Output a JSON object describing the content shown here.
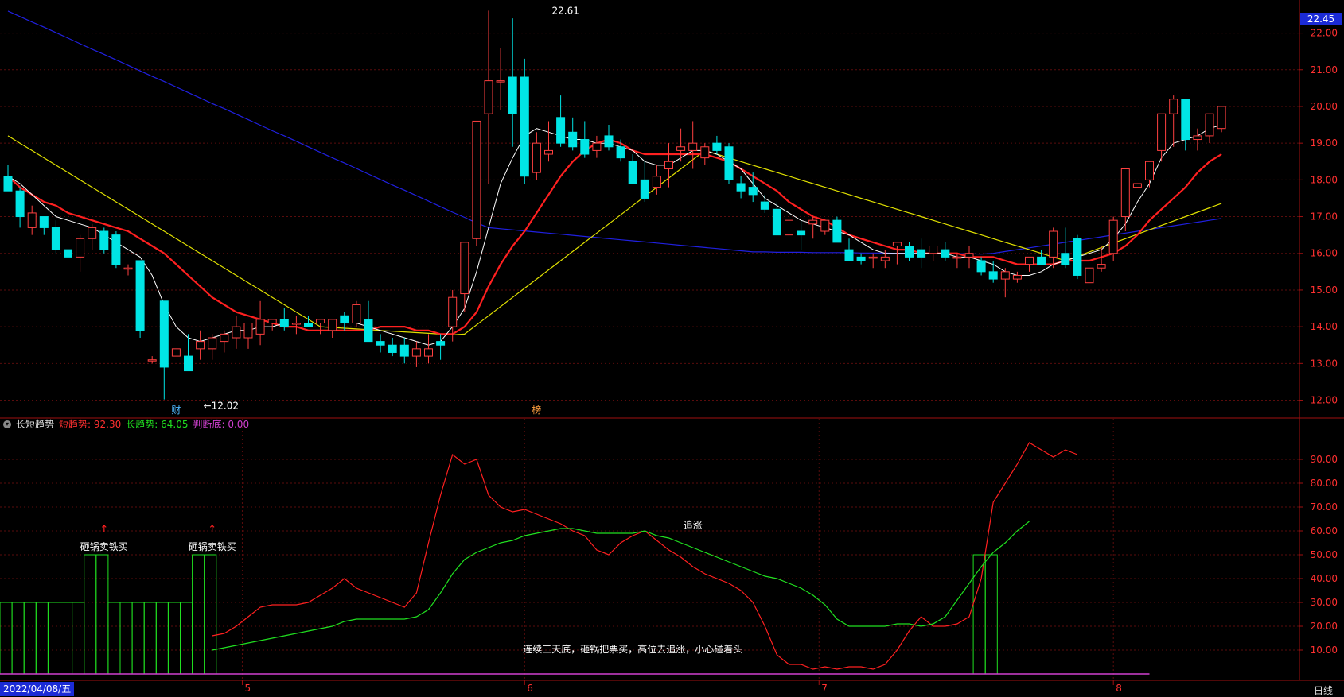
{
  "app": {
    "period_label": "日线",
    "last_price": "22.45",
    "date_label": "2022/04/08/五"
  },
  "indicator": {
    "name": "长短趋势",
    "short_label": "短趋势:",
    "short_value": "92.30",
    "long_label": "长趋势:",
    "long_value": "64.05",
    "judge_label": "判断底:",
    "judge_value": "0.00",
    "colors": {
      "short": "#ff3030",
      "long": "#20e020",
      "judge": "#d040d0"
    }
  },
  "chart_data": [
    {
      "type": "candlestick",
      "y_ticks": [
        "22.00",
        "21.00",
        "20.00",
        "19.00",
        "18.00",
        "17.00",
        "16.00",
        "15.00",
        "14.00",
        "13.00",
        "12.00"
      ],
      "ylim": [
        11.6,
        22.9
      ],
      "annotations": [
        {
          "text": "22.61",
          "x": 45,
          "y": 22.61
        },
        {
          "text": "←12.02",
          "x": 16,
          "y": 12.02
        }
      ],
      "markers": [
        {
          "text": "财",
          "x": 14,
          "color": "#4db8ff"
        },
        {
          "text": "榜",
          "x": 44,
          "color": "#ffa040"
        }
      ],
      "month_ticks": [
        {
          "label": "5",
          "x": 19.5
        },
        {
          "label": "6",
          "x": 43
        },
        {
          "label": "7",
          "x": 67.5
        },
        {
          "label": "8",
          "x": 92
        }
      ],
      "colors": {
        "up": "#ff4040",
        "down": "#00e5e5",
        "ma_white": "#ffffff",
        "ma_red": "#ff2020",
        "ma_yellow": "#e0e000",
        "ma_blue": "#2020e0"
      },
      "candles": [
        [
          18.1,
          18.4,
          17.7,
          17.7
        ],
        [
          17.7,
          17.8,
          16.7,
          17.0
        ],
        [
          16.7,
          17.3,
          16.5,
          17.1
        ],
        [
          17.0,
          17.0,
          16.5,
          16.7
        ],
        [
          16.7,
          16.9,
          16.0,
          16.1
        ],
        [
          16.1,
          16.3,
          15.6,
          15.9
        ],
        [
          15.9,
          16.5,
          15.5,
          16.4
        ],
        [
          16.4,
          16.8,
          16.1,
          16.7
        ],
        [
          16.6,
          16.7,
          16.0,
          16.1
        ],
        [
          16.5,
          16.6,
          15.6,
          15.7
        ],
        [
          15.6,
          15.7,
          15.4,
          15.6
        ],
        [
          15.8,
          15.8,
          13.7,
          13.9
        ],
        [
          13.1,
          13.2,
          13.0,
          13.1
        ],
        [
          14.7,
          14.7,
          12.02,
          12.9
        ],
        [
          13.2,
          13.3,
          13.2,
          13.4
        ],
        [
          13.2,
          13.8,
          12.8,
          12.8
        ],
        [
          13.4,
          13.9,
          13.1,
          13.6
        ],
        [
          13.4,
          13.8,
          13.1,
          13.7
        ],
        [
          13.6,
          13.9,
          13.3,
          13.8
        ],
        [
          13.7,
          14.3,
          13.4,
          14.0
        ],
        [
          13.7,
          14.1,
          13.4,
          14.1
        ],
        [
          13.8,
          14.7,
          13.5,
          14.2
        ],
        [
          14.1,
          14.2,
          13.9,
          14.2
        ],
        [
          14.2,
          14.5,
          13.9,
          14.0
        ],
        [
          14.1,
          14.3,
          13.8,
          14.1
        ],
        [
          14.1,
          14.3,
          14.0,
          14.0
        ],
        [
          14.1,
          14.2,
          13.8,
          14.2
        ],
        [
          13.9,
          14.0,
          13.7,
          14.2
        ],
        [
          14.3,
          14.4,
          13.9,
          14.1
        ],
        [
          14.1,
          14.7,
          14.0,
          14.6
        ],
        [
          14.2,
          14.7,
          13.8,
          13.6
        ],
        [
          13.6,
          13.8,
          13.3,
          13.5
        ],
        [
          13.5,
          13.7,
          13.2,
          13.3
        ],
        [
          13.5,
          13.7,
          13.0,
          13.2
        ],
        [
          13.2,
          13.6,
          12.9,
          13.4
        ],
        [
          13.2,
          13.8,
          13.0,
          13.4
        ],
        [
          13.6,
          13.8,
          13.1,
          13.5
        ],
        [
          14.0,
          15.0,
          13.6,
          14.8
        ],
        [
          14.9,
          16.2,
          14.4,
          16.3
        ],
        [
          16.4,
          17.7,
          16.2,
          19.6
        ],
        [
          19.8,
          22.61,
          17.9,
          20.7
        ],
        [
          20.7,
          21.6,
          19.9,
          20.7
        ],
        [
          20.8,
          22.4,
          18.9,
          19.8
        ],
        [
          20.8,
          21.3,
          17.9,
          18.1
        ],
        [
          18.2,
          19.3,
          18.0,
          19.0
        ],
        [
          18.7,
          19.6,
          18.5,
          18.8
        ],
        [
          19.7,
          20.3,
          18.9,
          19.0
        ],
        [
          19.3,
          19.7,
          18.8,
          18.9
        ],
        [
          19.1,
          19.6,
          18.6,
          18.7
        ],
        [
          18.8,
          19.2,
          18.6,
          19.0
        ],
        [
          19.2,
          19.5,
          18.8,
          18.9
        ],
        [
          18.9,
          19.1,
          18.5,
          18.6
        ],
        [
          18.5,
          18.7,
          17.9,
          17.9
        ],
        [
          18.0,
          18.5,
          17.4,
          17.5
        ],
        [
          17.8,
          18.4,
          17.6,
          18.1
        ],
        [
          18.3,
          19.0,
          17.8,
          18.5
        ],
        [
          18.8,
          19.4,
          18.5,
          18.9
        ],
        [
          18.8,
          19.6,
          18.3,
          19.0
        ],
        [
          18.6,
          19.0,
          18.4,
          18.9
        ],
        [
          19.0,
          19.2,
          18.7,
          18.8
        ],
        [
          18.9,
          19.0,
          17.9,
          18.0
        ],
        [
          17.9,
          18.1,
          17.5,
          17.7
        ],
        [
          17.8,
          18.2,
          17.4,
          17.6
        ],
        [
          17.4,
          17.6,
          17.1,
          17.2
        ],
        [
          17.2,
          17.4,
          16.5,
          16.5
        ],
        [
          16.5,
          16.9,
          16.2,
          16.9
        ],
        [
          16.6,
          16.9,
          16.1,
          16.5
        ],
        [
          16.8,
          17.0,
          16.4,
          16.9
        ],
        [
          16.6,
          16.9,
          16.5,
          16.9
        ],
        [
          16.9,
          17.0,
          16.3,
          16.3
        ],
        [
          16.1,
          16.4,
          15.8,
          15.8
        ],
        [
          15.9,
          16.0,
          15.7,
          15.8
        ],
        [
          15.9,
          16.0,
          15.6,
          15.9
        ],
        [
          15.8,
          16.1,
          15.6,
          15.9
        ],
        [
          16.2,
          16.3,
          15.7,
          16.3
        ],
        [
          16.2,
          16.3,
          15.8,
          15.9
        ],
        [
          16.1,
          16.4,
          15.6,
          15.9
        ],
        [
          16.0,
          16.2,
          15.8,
          16.2
        ],
        [
          16.1,
          16.3,
          15.8,
          15.9
        ],
        [
          15.9,
          16.0,
          15.6,
          15.9
        ],
        [
          15.9,
          16.2,
          15.6,
          16.0
        ],
        [
          15.8,
          15.9,
          15.4,
          15.5
        ],
        [
          15.5,
          15.8,
          15.2,
          15.3
        ],
        [
          15.3,
          15.6,
          14.8,
          15.5
        ],
        [
          15.3,
          15.5,
          15.2,
          15.4
        ],
        [
          15.7,
          15.9,
          15.5,
          15.9
        ],
        [
          15.9,
          16.1,
          15.7,
          15.7
        ],
        [
          15.9,
          16.7,
          15.6,
          16.6
        ],
        [
          16.0,
          16.7,
          15.6,
          15.7
        ],
        [
          16.4,
          16.5,
          15.3,
          15.4
        ],
        [
          15.2,
          15.6,
          15.2,
          15.6
        ],
        [
          15.6,
          16.2,
          15.5,
          15.7
        ],
        [
          16.0,
          17.0,
          15.8,
          16.9
        ],
        [
          17.0,
          18.3,
          16.6,
          18.3
        ],
        [
          17.8,
          17.9,
          17.8,
          17.9
        ],
        [
          18.0,
          18.3,
          17.8,
          18.5
        ],
        [
          18.8,
          19.1,
          18.5,
          19.8
        ],
        [
          19.8,
          20.3,
          18.9,
          20.2
        ],
        [
          20.2,
          20.2,
          18.8,
          19.1
        ],
        [
          19.1,
          19.4,
          18.8,
          19.2
        ],
        [
          19.2,
          19.7,
          19.0,
          19.8
        ],
        [
          19.4,
          20.0,
          19.3,
          20.0
        ]
      ],
      "ma_white": [
        18.1,
        17.9,
        17.6,
        17.3,
        17.0,
        16.9,
        16.8,
        16.7,
        16.5,
        16.3,
        16.1,
        15.9,
        15.4,
        14.6,
        14.0,
        13.7,
        13.6,
        13.7,
        13.8,
        13.9,
        13.9,
        14.0,
        14.0,
        14.1,
        14.1,
        14.1,
        14.1,
        14.1,
        14.1,
        14.1,
        14.0,
        13.9,
        13.8,
        13.7,
        13.6,
        13.5,
        13.6,
        14.0,
        14.5,
        15.5,
        16.7,
        17.9,
        18.6,
        19.2,
        19.4,
        19.3,
        19.2,
        19.1,
        19.1,
        19.0,
        19.0,
        18.9,
        18.8,
        18.5,
        18.4,
        18.4,
        18.6,
        18.8,
        18.8,
        18.7,
        18.5,
        18.3,
        17.9,
        17.5,
        17.3,
        17.1,
        16.9,
        16.8,
        16.7,
        16.6,
        16.5,
        16.3,
        16.1,
        16.0,
        16.0,
        16.0,
        16.0,
        16.0,
        16.0,
        15.9,
        15.9,
        15.8,
        15.7,
        15.5,
        15.4,
        15.4,
        15.5,
        15.7,
        15.8,
        15.9,
        16.0,
        16.1,
        16.4,
        16.8,
        17.4,
        17.9,
        18.6,
        19.0,
        19.1,
        19.2,
        19.4,
        19.5
      ],
      "ma_red": [
        18.1,
        17.8,
        17.6,
        17.4,
        17.3,
        17.1,
        17.0,
        16.9,
        16.8,
        16.7,
        16.6,
        16.4,
        16.2,
        16.0,
        15.7,
        15.4,
        15.1,
        14.8,
        14.6,
        14.4,
        14.3,
        14.2,
        14.1,
        14.0,
        14.0,
        13.9,
        13.9,
        13.9,
        13.9,
        13.9,
        13.9,
        14.0,
        14.0,
        14.0,
        13.9,
        13.9,
        13.8,
        13.8,
        14.0,
        14.4,
        15.1,
        15.7,
        16.2,
        16.6,
        17.1,
        17.6,
        18.1,
        18.5,
        18.8,
        19.0,
        19.1,
        19.0,
        18.8,
        18.7,
        18.7,
        18.7,
        18.7,
        18.7,
        18.7,
        18.6,
        18.5,
        18.3,
        18.1,
        17.9,
        17.7,
        17.4,
        17.2,
        17.0,
        16.9,
        16.7,
        16.5,
        16.4,
        16.3,
        16.2,
        16.1,
        16.1,
        16.0,
        16.0,
        16.0,
        16.0,
        15.9,
        15.9,
        15.9,
        15.8,
        15.7,
        15.7,
        15.7,
        15.7,
        15.8,
        15.8,
        15.8,
        15.9,
        16.0,
        16.2,
        16.5,
        16.9,
        17.2,
        17.5,
        17.8,
        18.2,
        18.5,
        18.7
      ]
    },
    {
      "type": "line",
      "y_ticks": [
        "90.00",
        "80.00",
        "70.00",
        "60.00",
        "50.00",
        "40.00",
        "30.00",
        "20.00",
        "10.00"
      ],
      "ylim": [
        0,
        100
      ],
      "series": [
        {
          "name": "短趋势",
          "color": "#ff2020",
          "values": [
            null,
            null,
            null,
            null,
            null,
            null,
            null,
            null,
            null,
            null,
            null,
            null,
            null,
            null,
            null,
            null,
            null,
            16,
            17,
            20,
            24,
            28,
            29,
            29,
            29,
            30,
            33,
            36,
            40,
            36,
            34,
            32,
            30,
            28,
            34,
            55,
            75,
            92,
            88,
            90,
            75,
            70,
            68,
            69,
            67,
            65,
            63,
            60,
            58,
            52,
            50,
            55,
            58,
            60,
            56,
            52,
            49,
            45,
            42,
            40,
            38,
            35,
            30,
            20,
            8,
            4,
            4,
            2,
            3,
            2,
            3,
            3,
            2,
            4,
            10,
            18,
            24,
            20,
            20,
            21,
            24,
            40,
            72,
            80,
            88,
            97,
            94,
            91,
            94,
            92
          ]
        },
        {
          "name": "长趋势",
          "color": "#20e020",
          "values": [
            null,
            null,
            null,
            null,
            null,
            null,
            null,
            null,
            null,
            null,
            null,
            null,
            null,
            null,
            null,
            null,
            null,
            10,
            11,
            12,
            13,
            14,
            15,
            16,
            17,
            18,
            19,
            20,
            22,
            23,
            23,
            23,
            23,
            23,
            24,
            27,
            34,
            42,
            48,
            51,
            53,
            55,
            56,
            58,
            59,
            60,
            61,
            61,
            60,
            59,
            59,
            59,
            59,
            60,
            58,
            57,
            55,
            53,
            51,
            49,
            47,
            45,
            43,
            41,
            40,
            38,
            36,
            33,
            29,
            23,
            20,
            20,
            20,
            20,
            21,
            21,
            20,
            21,
            24,
            31,
            38,
            45,
            51,
            55,
            60,
            64
          ]
        },
        {
          "name": "判断底",
          "color": "#d040d0",
          "values": [
            0
          ]
        }
      ],
      "bars": [
        {
          "x": 0,
          "v": 30
        },
        {
          "x": 1,
          "v": 30
        },
        {
          "x": 2,
          "v": 30
        },
        {
          "x": 3,
          "v": 30
        },
        {
          "x": 4,
          "v": 30
        },
        {
          "x": 5,
          "v": 30
        },
        {
          "x": 6,
          "v": 30
        },
        {
          "x": 7,
          "v": 50
        },
        {
          "x": 8,
          "v": 50
        },
        {
          "x": 9,
          "v": 30
        },
        {
          "x": 10,
          "v": 30
        },
        {
          "x": 11,
          "v": 30
        },
        {
          "x": 12,
          "v": 30
        },
        {
          "x": 13,
          "v": 30
        },
        {
          "x": 14,
          "v": 30
        },
        {
          "x": 15,
          "v": 30
        },
        {
          "x": 16,
          "v": 50
        },
        {
          "x": 17,
          "v": 50
        },
        {
          "x": 81,
          "v": 50
        },
        {
          "x": 82,
          "v": 50
        }
      ],
      "annotations": [
        {
          "text": "砸锅卖铁买",
          "x": 8,
          "y": 52
        },
        {
          "text": "砸锅卖铁买",
          "x": 17,
          "y": 52
        },
        {
          "text": "追涨",
          "x": 57,
          "y": 61
        },
        {
          "text": "连续三天底，砸锅把票买，高位去追涨，小心碰着头",
          "x": 52,
          "y": 9
        }
      ]
    }
  ]
}
